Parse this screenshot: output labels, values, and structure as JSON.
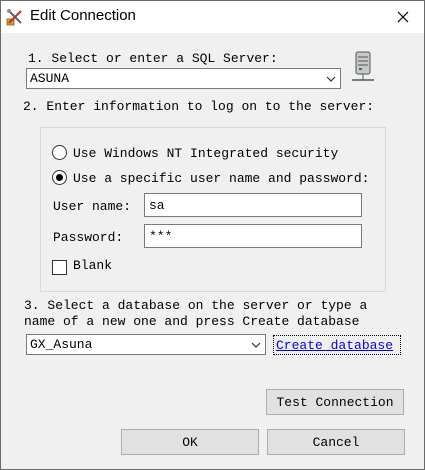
{
  "window": {
    "title": "Edit Connection"
  },
  "step1": {
    "label": "Select or enter a SQL Server:",
    "server_value": "ASUNA"
  },
  "step2": {
    "label": "Enter information to log on to the server:"
  },
  "auth": {
    "windows_nt_label": "Use Windows NT Integrated security",
    "specific_user_label": "Use a specific user name and password:",
    "selected": "specific_user"
  },
  "credentials": {
    "username_label": "User name:",
    "username_value": "sa",
    "password_label": "Password:",
    "password_value": "***",
    "blank_label": "Blank"
  },
  "step3": {
    "label_line1": "Select a database on the server or type a",
    "label_line2": "name of a new one and press Create database",
    "database_value": "GX_Asuna",
    "create_link": "Create database"
  },
  "buttons": {
    "test": "Test Connection",
    "ok": "OK",
    "cancel": "Cancel"
  },
  "icons": {
    "title": "tools-icon",
    "server": "server-icon",
    "close": "close-icon"
  }
}
